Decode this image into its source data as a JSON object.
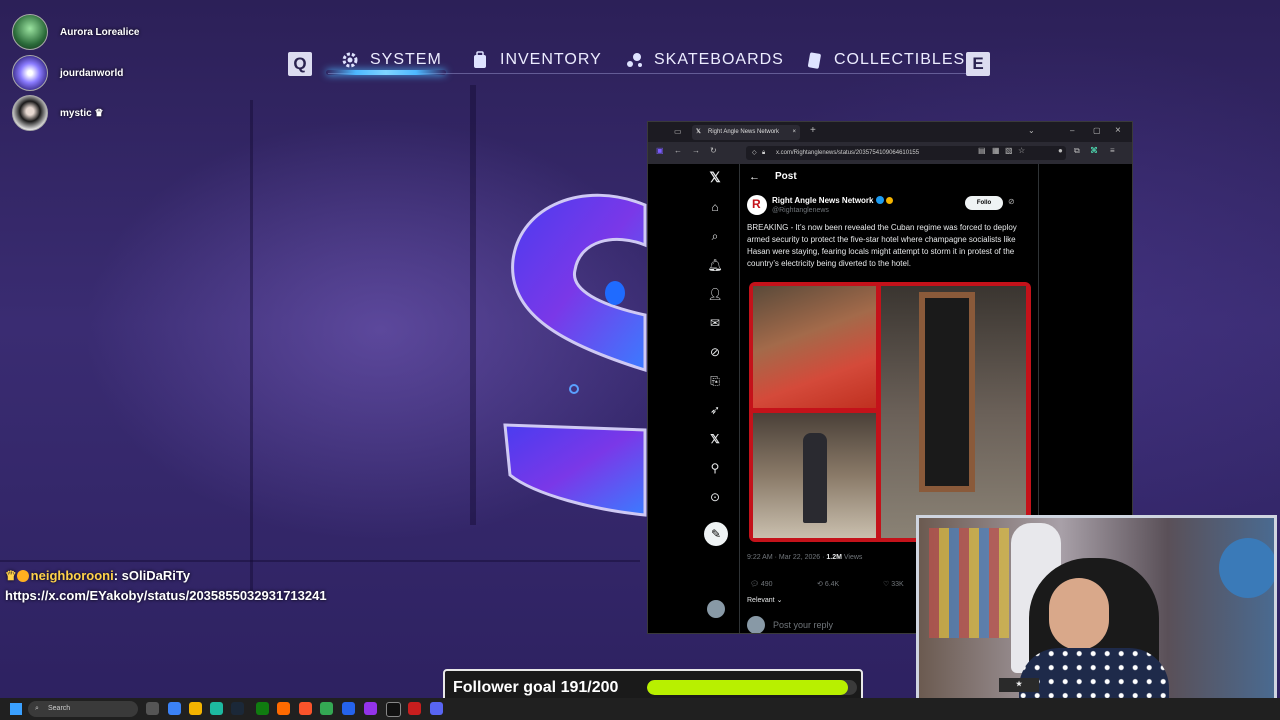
{
  "top_nav": {
    "left_key": "Q",
    "right_key": "E",
    "tabs": [
      {
        "label": "SYSTEM",
        "icon": "gear-icon",
        "active": true
      },
      {
        "label": "INVENTORY",
        "icon": "backpack-icon",
        "active": false
      },
      {
        "label": "SKATEBOARDS",
        "icon": "paint-icon",
        "active": false
      },
      {
        "label": "COLLECTIBLES",
        "icon": "card-icon",
        "active": false
      }
    ]
  },
  "viewers": [
    {
      "name": "Aurora Lorealice",
      "icon": "avatar"
    },
    {
      "name": "jourdanworld",
      "icon": "avatar"
    },
    {
      "name": "mystic",
      "icon": "avatar"
    }
  ],
  "chat": {
    "username": "neighborooni",
    "message": "sOliDaRiTy",
    "link": "https://x.com/EYakoby/status/2035855032931713241",
    "badges": [
      "crown-icon",
      "sub-badge-icon"
    ]
  },
  "browser": {
    "tab_title": "Right Angle News Network",
    "url": "x.com/Rightanglenews/status/2035754109064610155",
    "page_heading": "Post",
    "sidebar_icons": [
      "x-logo-icon",
      "home-icon",
      "search-icon",
      "bell-icon",
      "people-icon",
      "mail-icon",
      "grok-icon",
      "bookmark-icon",
      "rocket-icon",
      "x-icon",
      "profile-icon",
      "more-icon",
      "post-icon"
    ],
    "tweet": {
      "author": "Right Angle News Network",
      "handle": "@Rightanglenews",
      "follow_label": "Follo",
      "text": "BREAKING - It’s now been revealed the Cuban regime was forced to deploy armed security to protect the five-star hotel where champagne socialists like Hasan were staying, fearing locals might attempt to storm it in protest of the country’s electricity being diverted to the hotel.",
      "timestamp": "9:22 AM · Mar 22, 2026 · ",
      "views_count": "1.2M",
      "views_label": " Views",
      "replies": "490",
      "reposts": "6.4K",
      "likes": "33K",
      "sort_label": "Relevant",
      "reply_placeholder": "Post your reply"
    }
  },
  "follower_goal": {
    "label": "Follower goal 191/200",
    "current": 191,
    "target": 200,
    "bar_color": "#b8f000"
  },
  "taskbar": {
    "search_placeholder": "Search"
  },
  "colors": {
    "accent_blue": "#4db8ff",
    "game_bg": "#2c2058",
    "verified_blue": "#1d9bf0",
    "photo_frame_red": "#c4121a"
  }
}
